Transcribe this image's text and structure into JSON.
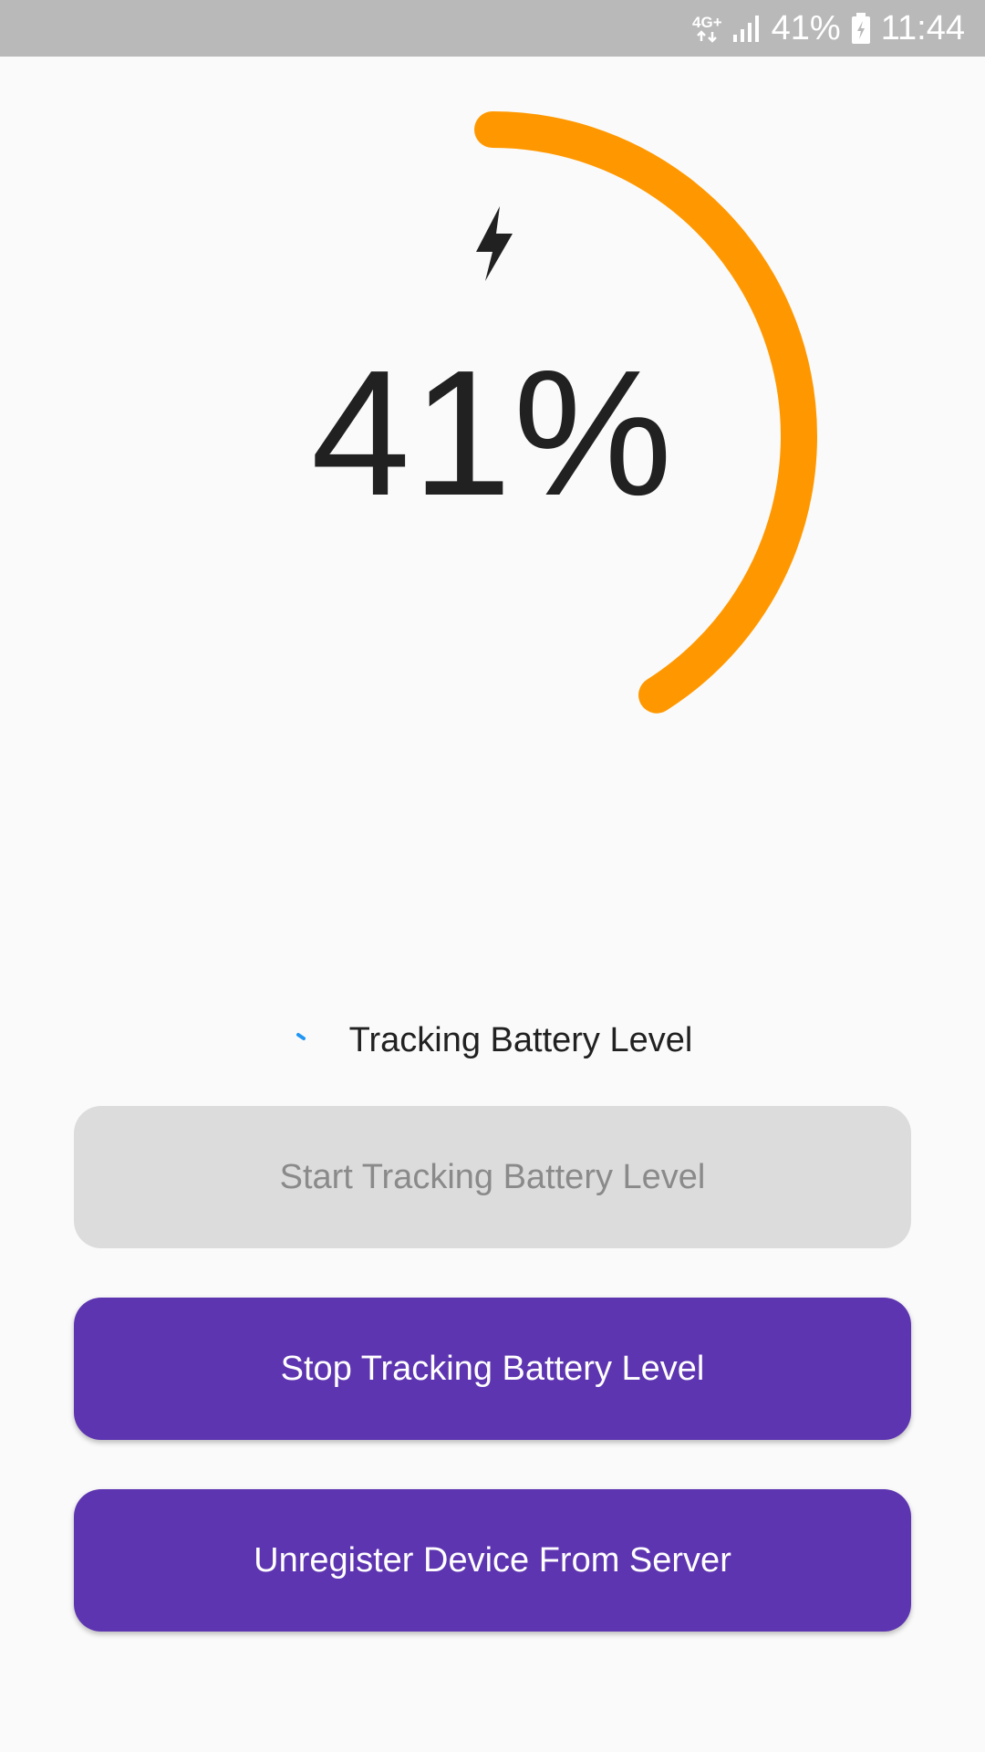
{
  "status_bar": {
    "network": "4G+",
    "battery_percent": "41%",
    "time": "11:44"
  },
  "battery": {
    "level_text": "41%",
    "level_fraction": 0.41,
    "arc_color": "#ff9800",
    "icon": "lightning-bolt-icon"
  },
  "tracking": {
    "status_text": "Tracking Battery Level"
  },
  "buttons": {
    "start_label": "Start Tracking Battery Level",
    "stop_label": "Stop Tracking Battery Level",
    "unregister_label": "Unregister Device From Server"
  },
  "colors": {
    "primary": "#5e35b1",
    "disabled_bg": "#dcdcdc",
    "spinner": "#2196f3"
  }
}
